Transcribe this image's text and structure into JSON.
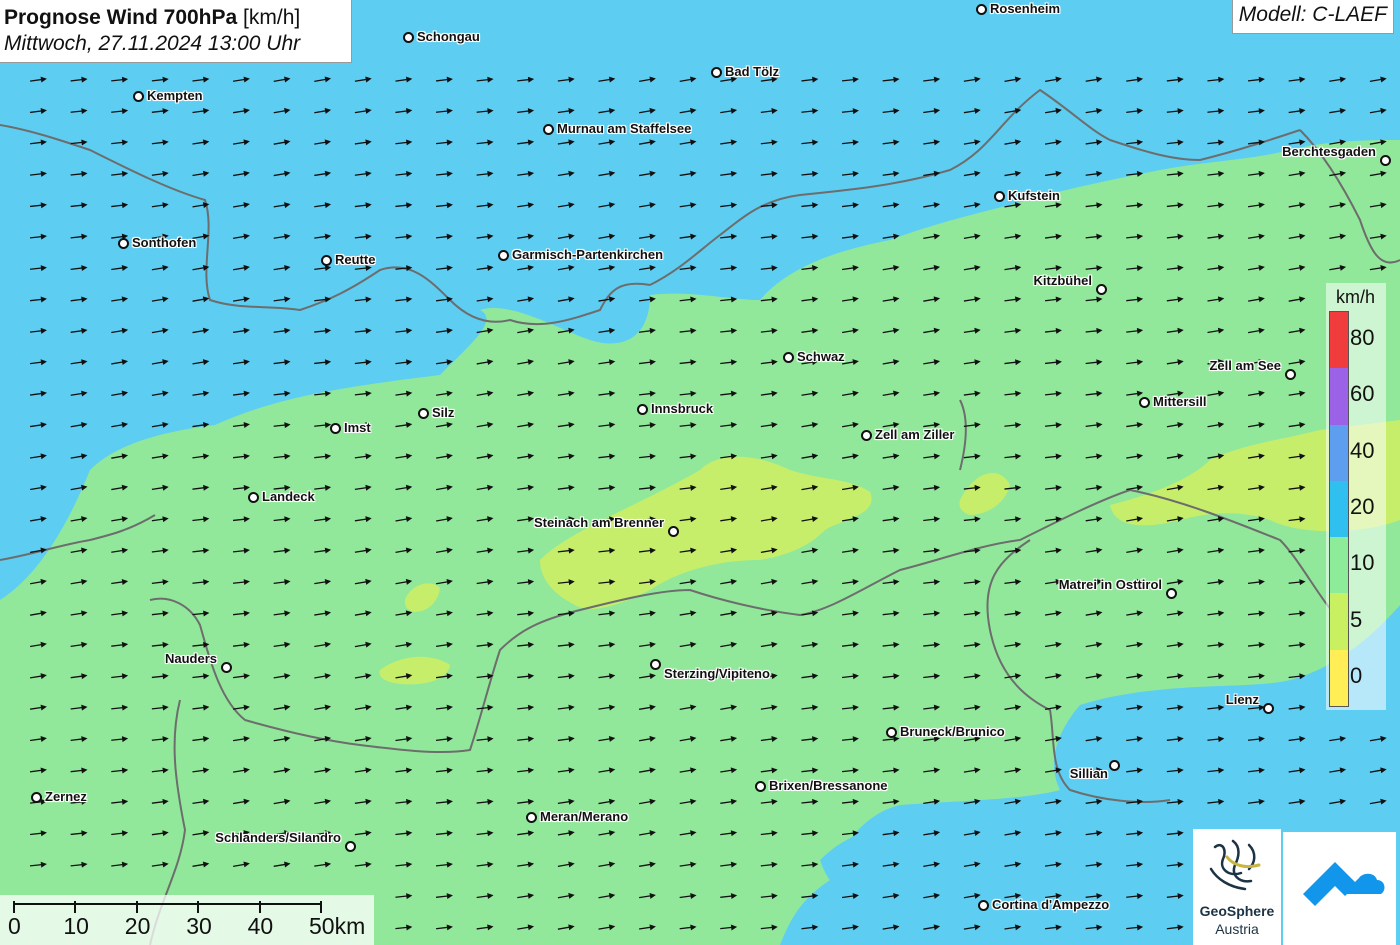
{
  "title": {
    "main": "Prognose Wind 700hPa",
    "unit": "[km/h]",
    "subtitle": "Mittwoch, 27.11.2024 13:00 Uhr"
  },
  "model": "Modell: C-LAEF",
  "legend": {
    "unit": "km/h",
    "labels": [
      "80",
      "60",
      "40",
      "20",
      "10",
      "5",
      "0"
    ],
    "colors": [
      "#f03c3c",
      "#9b62e8",
      "#5d9eee",
      "#2fc0f0",
      "#8cec9a",
      "#c8f060",
      "#ffee55"
    ]
  },
  "scalebar": {
    "labels": [
      "0",
      "10",
      "20",
      "30",
      "40",
      "50km"
    ]
  },
  "logos": {
    "geosphere_line1": "GeoSphere",
    "geosphere_line2": "Austria"
  },
  "colors": {
    "zone_10_20": "#92e89a",
    "zone_20_40": "#5ecdf2",
    "zone_5_10": "#ccee66",
    "border": "#6d6d6d",
    "arrow": "#111111"
  },
  "wind_arrows": {
    "direction": "east-northeast",
    "icon": "wind-arrow-icon"
  },
  "cities": [
    {
      "name": "Rosenheim"
    },
    {
      "name": "Schongau"
    },
    {
      "name": "Bad Tölz"
    },
    {
      "name": "Kempten"
    },
    {
      "name": "Murnau am Staffelsee"
    },
    {
      "name": "Berchtesgaden"
    },
    {
      "name": "Kufstein"
    },
    {
      "name": "Sonthofen"
    },
    {
      "name": "Reutte"
    },
    {
      "name": "Garmisch-Partenkirchen"
    },
    {
      "name": "Kitzbühel"
    },
    {
      "name": "Schwaz"
    },
    {
      "name": "Zell am See"
    },
    {
      "name": "Mittersill"
    },
    {
      "name": "Silz"
    },
    {
      "name": "Innsbruck"
    },
    {
      "name": "Imst"
    },
    {
      "name": "Zell am Ziller"
    },
    {
      "name": "Landeck"
    },
    {
      "name": "Steinach am Brenner"
    },
    {
      "name": "Matrei in Osttirol"
    },
    {
      "name": "Nauders"
    },
    {
      "name": "Sterzing/Vipiteno"
    },
    {
      "name": "Lienz"
    },
    {
      "name": "Bruneck/Brunico"
    },
    {
      "name": "Sillian"
    },
    {
      "name": "Brixen/Bressanone"
    },
    {
      "name": "Zernez"
    },
    {
      "name": "Meran/Merano"
    },
    {
      "name": "Schlanders/Silandro"
    },
    {
      "name": "Cortina d'Ampezzo"
    }
  ]
}
